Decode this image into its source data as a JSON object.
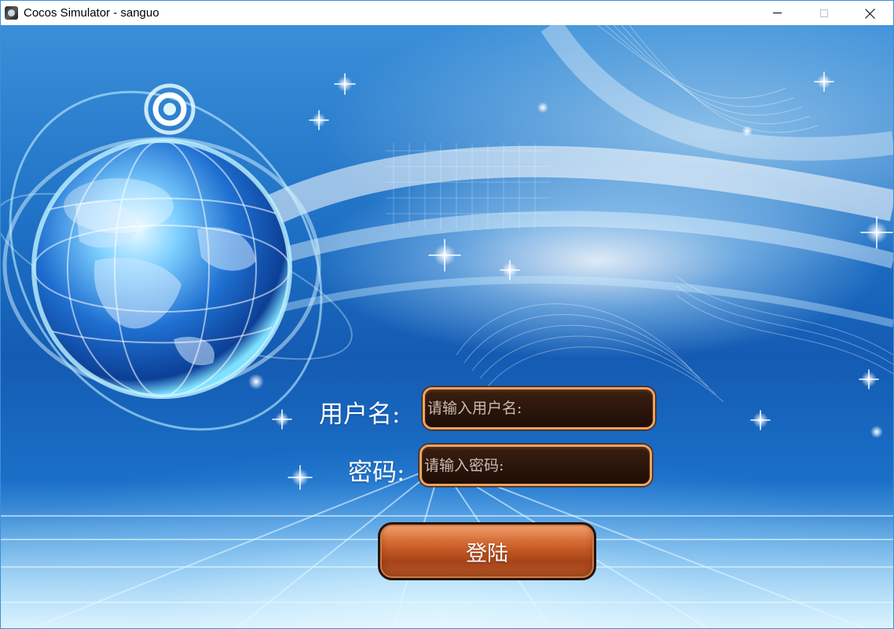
{
  "window": {
    "title": "Cocos Simulator - sanguo",
    "icon": "cocos-app-icon",
    "controls": [
      "minimize-icon",
      "maximize-icon",
      "close-icon"
    ]
  },
  "login_form": {
    "username_label": "用户名:",
    "username_placeholder": "请输入用户名:",
    "password_label": "密码:",
    "password_placeholder": "请输入密码:",
    "login_button_label": "登陆"
  },
  "colors": {
    "input_border": "#f0a25e",
    "input_fill": "#2b150a",
    "button_fill": "#c65a24",
    "background": "#1d6fc4"
  }
}
